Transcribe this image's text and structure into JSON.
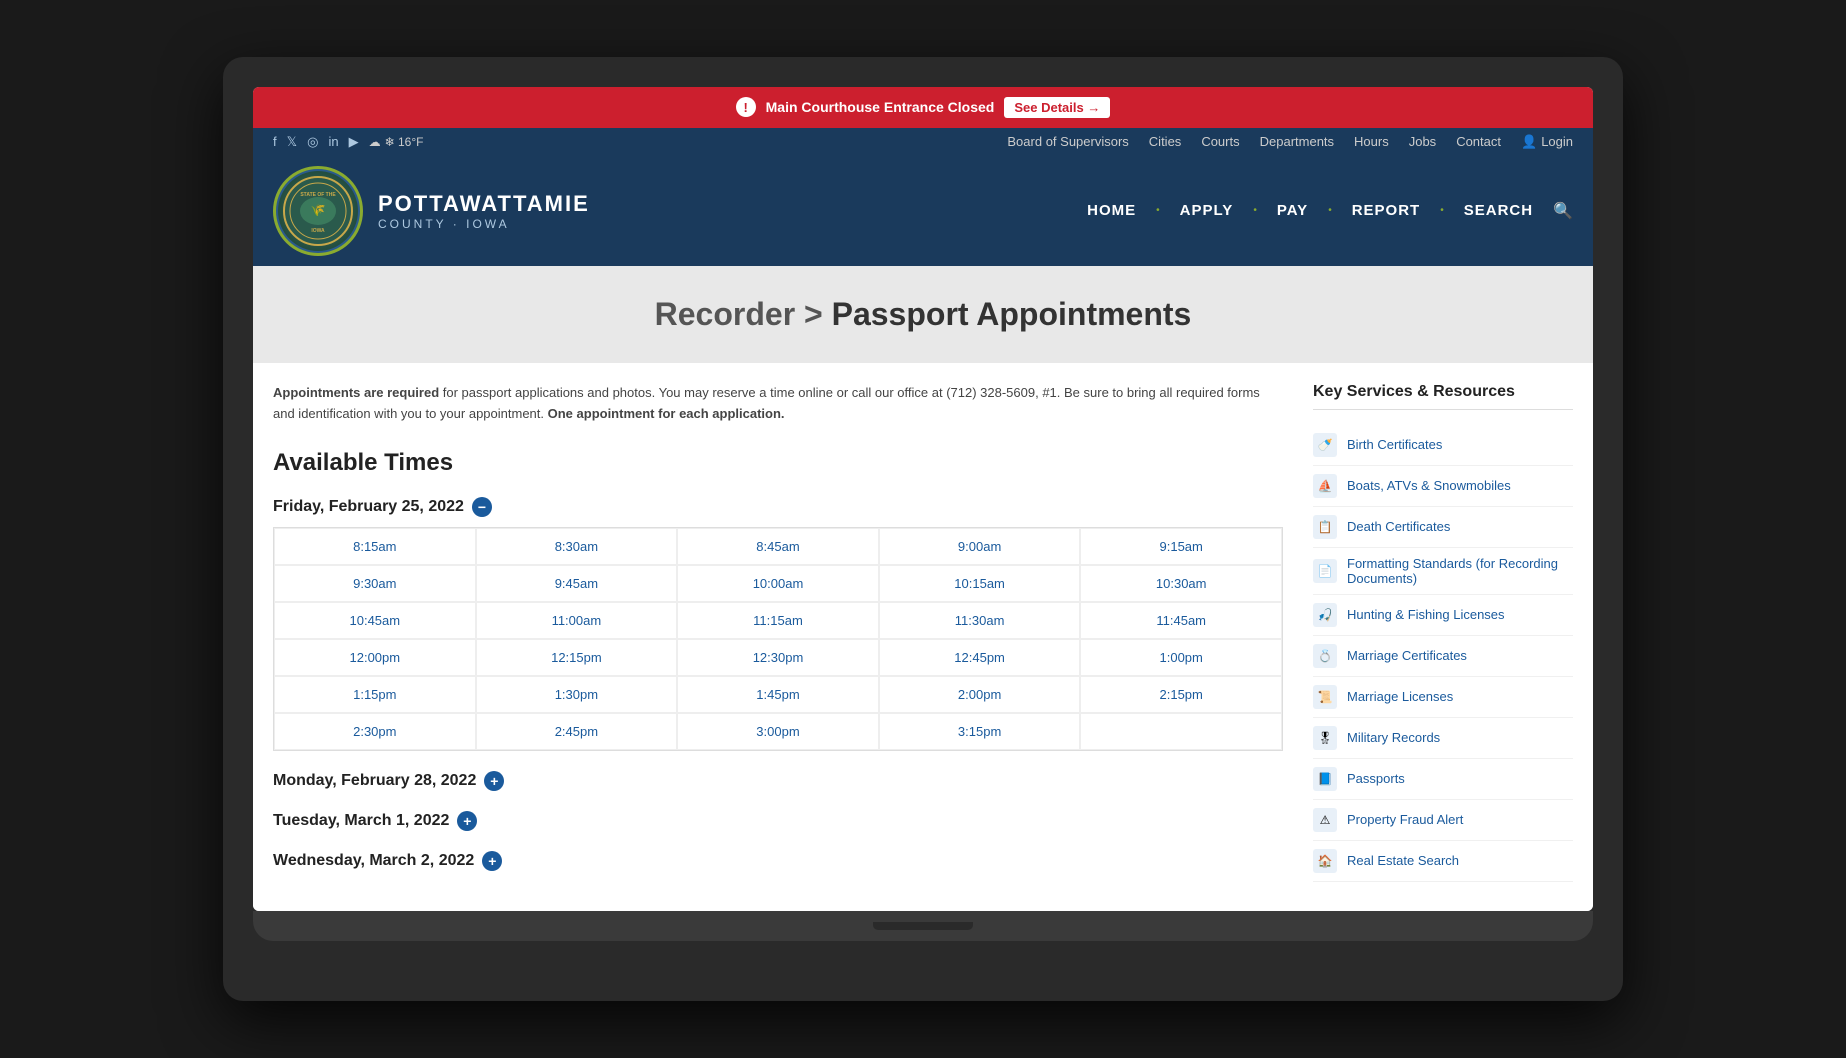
{
  "alert": {
    "icon": "!",
    "message": "Main Courthouse Entrance Closed",
    "link_text": "See Details →"
  },
  "utility_bar": {
    "social_icons": [
      "f",
      "🐦",
      "📷",
      "in",
      "▶",
      "☁"
    ],
    "weather": "❄ 16°F",
    "nav_links": [
      "Board of Supervisors",
      "Cities",
      "Courts",
      "Departments",
      "Hours",
      "Jobs",
      "Contact"
    ],
    "login": "Login"
  },
  "header": {
    "county_name": "POTTAWATTAMIE",
    "county_sub": "COUNTY · IOWA",
    "nav_items": [
      "HOME",
      "APPLY",
      "PAY",
      "REPORT",
      "SEARCH"
    ]
  },
  "page_title": {
    "breadcrumb": "Recorder >",
    "title": "Passport Appointments"
  },
  "content": {
    "intro_required": "Appointments are required",
    "intro_rest": " for passport applications and photos. You may reserve a time online or call our office at (712) 328-5609, #1. Be sure to bring all required forms and identification with you to your appointment.",
    "intro_bold": " One appointment for each application.",
    "section_title": "Available Times",
    "days": [
      {
        "label": "Friday, February 25, 2022",
        "toggle": "−",
        "expanded": true,
        "times": [
          "8:15am",
          "8:30am",
          "8:45am",
          "9:00am",
          "9:15am",
          "9:30am",
          "9:45am",
          "10:00am",
          "10:15am",
          "10:30am",
          "10:45am",
          "11:00am",
          "11:15am",
          "11:30am",
          "11:45am",
          "12:00pm",
          "12:15pm",
          "12:30pm",
          "12:45pm",
          "1:00pm",
          "1:15pm",
          "1:30pm",
          "1:45pm",
          "2:00pm",
          "2:15pm",
          "2:30pm",
          "2:45pm",
          "3:00pm",
          "3:15pm",
          ""
        ]
      },
      {
        "label": "Monday, February 28, 2022",
        "toggle": "+",
        "expanded": false,
        "times": []
      },
      {
        "label": "Tuesday, March 1, 2022",
        "toggle": "+",
        "expanded": false,
        "times": []
      },
      {
        "label": "Wednesday, March 2, 2022",
        "toggle": "+",
        "expanded": false,
        "times": []
      }
    ]
  },
  "sidebar": {
    "title": "Key Services & Resources",
    "items": [
      {
        "label": "Birth Certificates",
        "icon": "🍼"
      },
      {
        "label": "Boats, ATVs & Snowmobiles",
        "icon": "⛵"
      },
      {
        "label": "Death Certificates",
        "icon": "📋"
      },
      {
        "label": "Formatting Standards (for Recording Documents)",
        "icon": "📄"
      },
      {
        "label": "Hunting & Fishing Licenses",
        "icon": "🎣"
      },
      {
        "label": "Marriage Certificates",
        "icon": "💍"
      },
      {
        "label": "Marriage Licenses",
        "icon": "📜"
      },
      {
        "label": "Military Records",
        "icon": "🎖"
      },
      {
        "label": "Passports",
        "icon": "📘"
      },
      {
        "label": "Property Fraud Alert",
        "icon": "⚠"
      },
      {
        "label": "Real Estate Search",
        "icon": "🏠"
      }
    ]
  }
}
